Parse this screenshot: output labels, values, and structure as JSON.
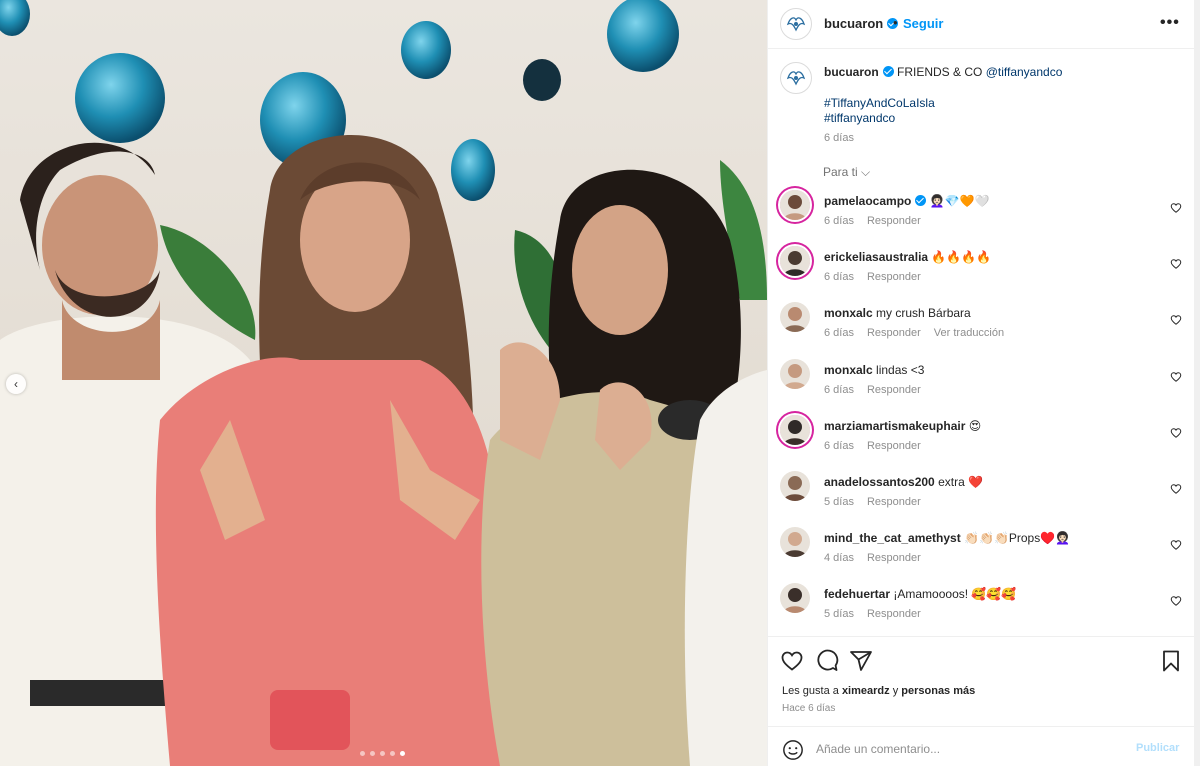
{
  "header": {
    "username": "bucuaron",
    "separator": "•",
    "follow_label": "Seguir",
    "more_label": "•••"
  },
  "caption": {
    "username": "bucuaron",
    "text": "FRIENDS & CO",
    "mention": "@tiffanyandco",
    "hashtags": [
      "#TiffanyAndCoLaIsla",
      "#tiffanyandco"
    ],
    "time": "6 días"
  },
  "for_you_label": "Para ti",
  "comments": [
    {
      "username": "pamelaocampo",
      "verified": true,
      "text": "👩🏻‍🦱💎🧡🤍",
      "time": "6 días",
      "reply": "Responder",
      "story": true
    },
    {
      "username": "erickeliasaustralia",
      "text": "🔥🔥🔥🔥",
      "time": "6 días",
      "reply": "Responder",
      "story": true
    },
    {
      "username": "monxalc",
      "text": "my crush Bárbara",
      "time": "6 días",
      "reply": "Responder",
      "translate": "Ver traducción"
    },
    {
      "username": "monxalc",
      "text": "lindas <3",
      "time": "6 días",
      "reply": "Responder"
    },
    {
      "username": "marziamartismakeuphair",
      "text": "😍",
      "time": "6 días",
      "reply": "Responder",
      "story": true
    },
    {
      "username": "anadelossantos200",
      "text": "extra ❤️",
      "time": "5 días",
      "reply": "Responder"
    },
    {
      "username": "mind_the_cat_amethyst",
      "text": "👏🏻👏🏻👏🏻Props♥️👩🏻‍🦱",
      "time": "4 días",
      "reply": "Responder"
    },
    {
      "username": "fedehuertar",
      "text": "¡Amamoooos! 🥰🥰🥰",
      "time": "5 días",
      "reply": "Responder"
    }
  ],
  "actions": {
    "likes_prefix": "Les gusta a",
    "likes_user": "ximeardz",
    "likes_conj": "y",
    "likes_rest": "personas más",
    "time": "Hace 6 días"
  },
  "add_comment": {
    "placeholder": "Añade un comentario...",
    "publish_label": "Publicar"
  },
  "carousel": {
    "dots": 5,
    "active": 5,
    "prev_label": "‹"
  },
  "colors": {
    "accent": "#0095f6",
    "link": "#00376b",
    "muted": "#8e8e8e",
    "publish_disabled": "#b2dffc"
  }
}
